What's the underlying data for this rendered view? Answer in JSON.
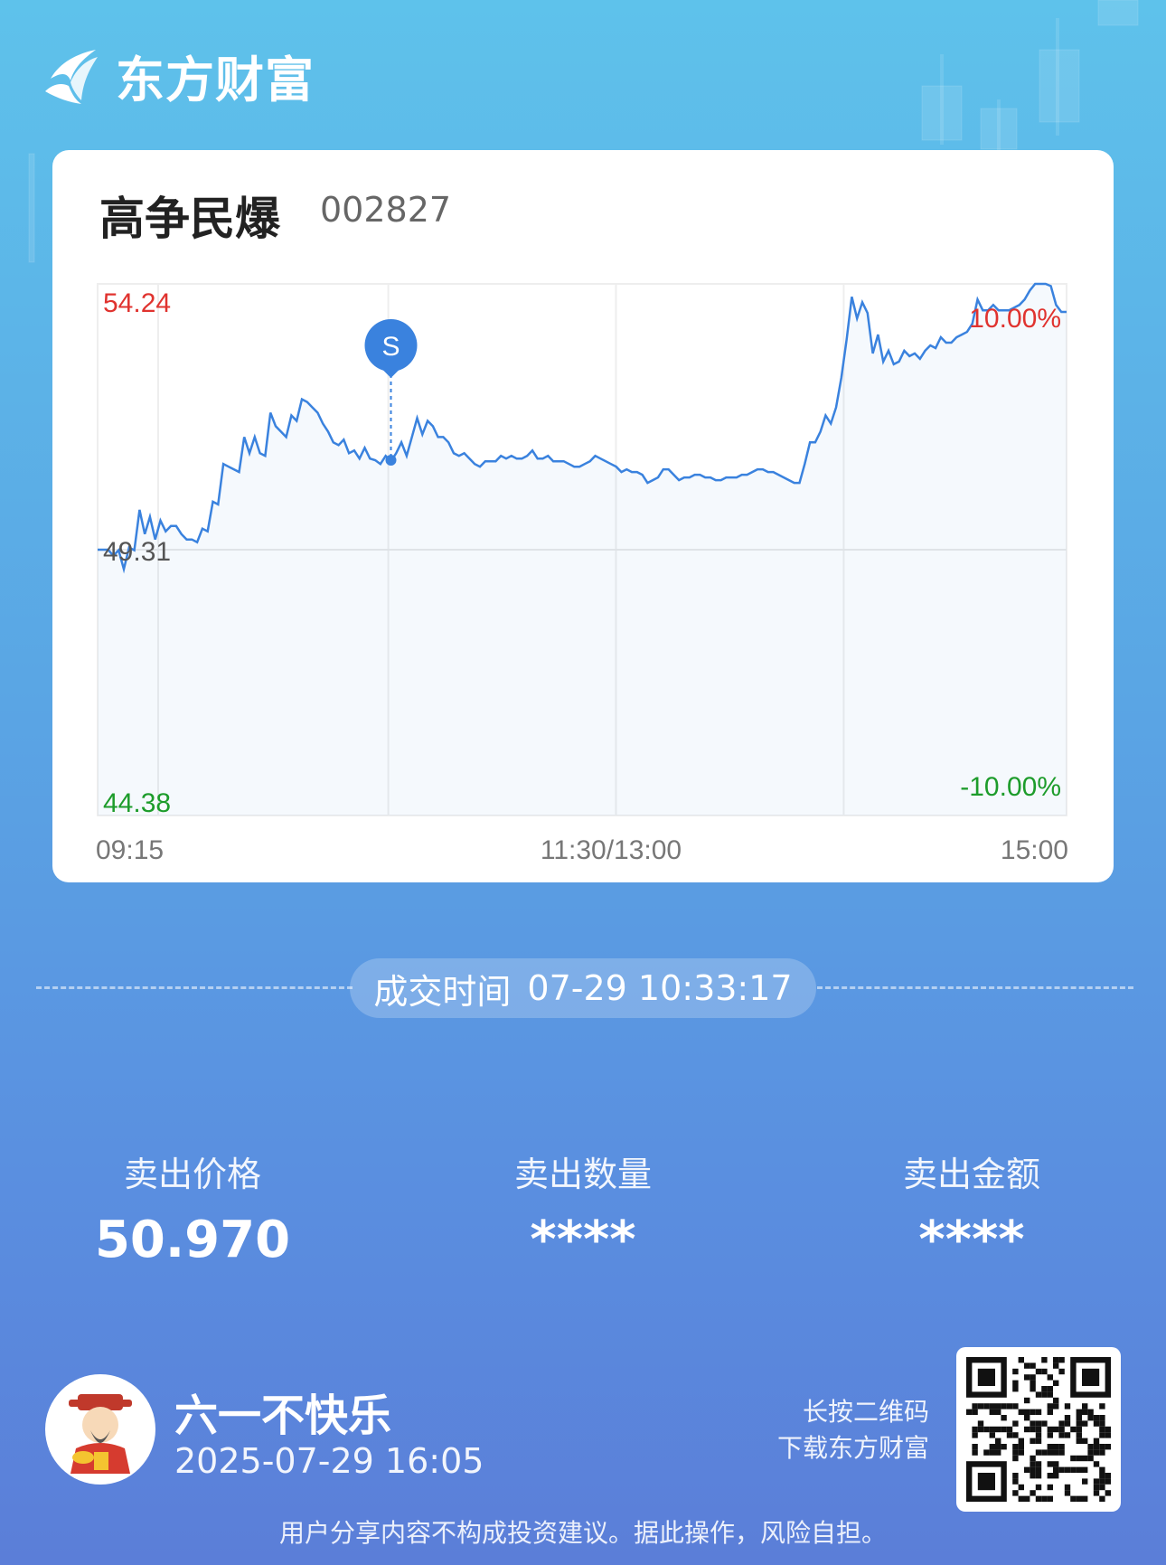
{
  "brand": {
    "name": "东方财富"
  },
  "stock": {
    "name": "高争民爆",
    "code": "002827"
  },
  "chart_data": {
    "type": "line",
    "x_labels": [
      "09:15",
      "11:30/13:00",
      "15:00"
    ],
    "y_labels": {
      "high": "54.24",
      "base": "49.31",
      "low": "44.38"
    },
    "pct_labels": {
      "high": "10.00%",
      "low": "-10.00%"
    },
    "ylim": [
      44.38,
      54.24
    ],
    "base_price": 49.31,
    "grid": true,
    "series": [
      {
        "values": [
          49.31,
          49.31,
          49.31,
          49.2,
          49.3,
          48.95,
          49.35,
          49.3,
          50.05,
          49.6,
          49.92,
          49.5,
          49.85,
          49.65,
          49.75,
          49.75,
          49.6,
          49.5,
          49.5,
          49.45,
          49.7,
          49.65,
          50.2,
          50.15,
          50.9,
          50.85,
          50.8,
          50.75,
          51.4,
          51.1,
          51.4,
          51.1,
          51.05,
          51.85,
          51.6,
          51.5,
          51.4,
          51.8,
          51.7,
          52.1,
          52.05,
          51.95,
          51.85,
          51.65,
          51.5,
          51.3,
          51.25,
          51.35,
          51.1,
          51.15,
          51.0,
          51.2,
          51.0,
          50.97,
          50.9,
          51.05,
          50.95,
          51.1,
          51.3,
          51.05,
          51.4,
          51.75,
          51.45,
          51.7,
          51.6,
          51.4,
          51.4,
          51.3,
          51.1,
          51.05,
          51.1,
          51.0,
          50.9,
          50.85,
          50.95,
          50.95,
          50.95,
          51.05,
          51.0,
          51.05,
          51.0,
          51.0,
          51.05,
          51.15,
          51.0,
          51.0,
          51.05,
          50.95,
          50.95,
          50.95,
          50.9,
          50.85,
          50.85,
          50.9,
          50.95,
          51.05,
          51.0,
          50.95,
          50.9,
          50.85,
          50.75,
          50.8,
          50.75,
          50.75,
          50.7,
          50.55,
          50.6,
          50.65,
          50.8,
          50.8,
          50.7,
          50.6,
          50.65,
          50.65,
          50.7,
          50.7,
          50.65,
          50.65,
          50.6,
          50.6,
          50.65,
          50.65,
          50.65,
          50.7,
          50.7,
          50.75,
          50.8,
          50.8,
          50.75,
          50.75,
          50.7,
          50.65,
          50.6,
          50.55,
          50.55,
          50.9,
          51.3,
          51.3,
          51.5,
          51.8,
          51.65,
          51.95,
          52.5,
          53.2,
          54.0,
          53.6,
          53.9,
          53.7,
          52.95,
          53.3,
          52.8,
          53.0,
          52.75,
          52.8,
          53.0,
          52.9,
          52.95,
          52.85,
          53.0,
          53.1,
          53.05,
          53.25,
          53.15,
          53.15,
          53.25,
          53.3,
          53.35,
          53.5,
          53.95,
          53.75,
          53.75,
          53.85,
          53.75,
          53.75,
          53.75,
          53.8,
          53.85,
          53.95,
          54.12,
          54.24,
          54.24,
          54.24,
          54.2,
          53.85,
          53.72,
          53.72
        ]
      }
    ]
  },
  "trade": {
    "time_label": "成交时间",
    "time_value": "07-29 10:33:17"
  },
  "stats": [
    {
      "label": "卖出价格",
      "value": "50.970"
    },
    {
      "label": "卖出数量",
      "value": "****"
    },
    {
      "label": "卖出金额",
      "value": "****"
    }
  ],
  "marker": {
    "label": "S",
    "index": 56,
    "price": 50.97
  },
  "user": {
    "name": "六一不快乐",
    "time": "2025-07-29 16:05"
  },
  "qr_hint": {
    "line1": "长按二维码",
    "line2": "下载东方财富"
  },
  "disclaimer": "用户分享内容不构成投资建议。据此操作，风险自担。",
  "colors": {
    "line": "#3a82de",
    "up": "#e0332f",
    "down": "#1d9c2b"
  }
}
